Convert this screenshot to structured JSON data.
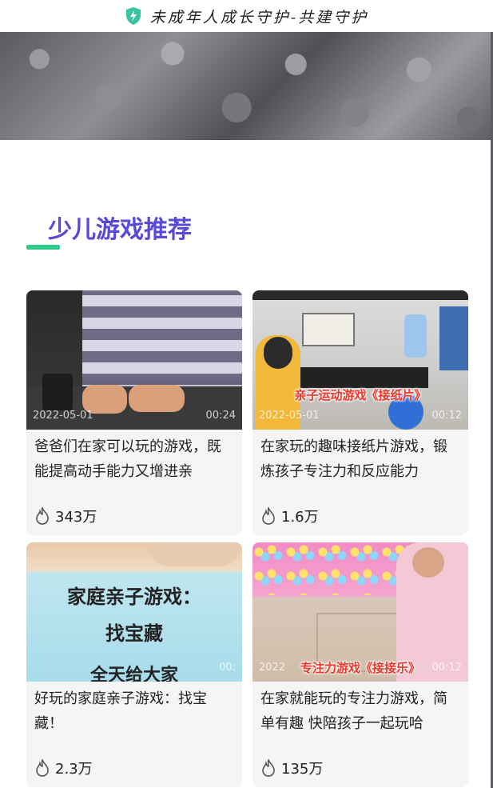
{
  "header": {
    "slogan": "未成年人成长守护-共建守护"
  },
  "section": {
    "title": "少儿游戏推荐"
  },
  "cards": [
    {
      "date": "2022-05-01",
      "duration": "00:24",
      "description": "爸爸们在家可以玩的游戏，既能提高动手能力又增进亲",
      "views": "343万",
      "overlay": ""
    },
    {
      "date": "2022-05-01",
      "duration": "00:12",
      "description": "在家玩的趣味接纸片游戏，锻炼孩子专注力和反应能力",
      "views": "1.6万",
      "overlay": "亲子运动游戏《接纸片》"
    },
    {
      "date": "",
      "duration": "00:",
      "description": "好玩的家庭亲子游戏：找宝藏！",
      "views": "2.3万",
      "overlay": "家庭亲子游戏：",
      "overlay2": "找宝藏",
      "overlay3": "全天给大家"
    },
    {
      "date": "2022",
      "duration": "00:12",
      "description": "在家就能玩的专注力游戏，简单有趣 快陪孩子一起玩哈",
      "views": "135万",
      "overlay": "专注力游戏《接接乐》"
    }
  ],
  "colors": {
    "accent": "#5a48d6",
    "underline": "#2ecc88",
    "overlay_red": "#e8372c"
  }
}
